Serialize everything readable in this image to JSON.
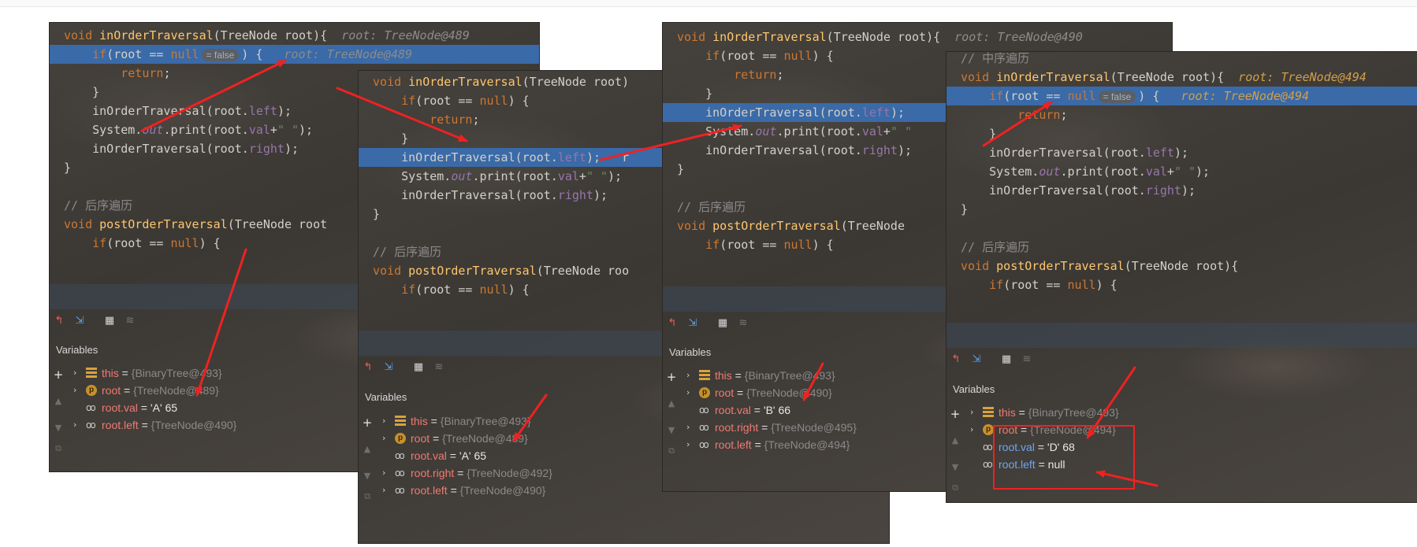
{
  "panels": [
    {
      "code": [
        [
          [
            "k",
            "void "
          ],
          [
            "fn",
            "inOrderTraversal"
          ],
          [
            "t",
            "(TreeNode root){  "
          ],
          [
            "hint",
            "root: TreeNode@489"
          ]
        ],
        [
          [
            "t",
            "    "
          ],
          [
            "k",
            "if"
          ],
          [
            "t",
            "(root == "
          ],
          [
            "k",
            "null"
          ],
          [
            "pill",
            "= false"
          ],
          [
            "t",
            ") {   "
          ],
          [
            "hint",
            "root: TreeNode@489"
          ]
        ],
        [
          [
            "t",
            "        "
          ],
          [
            "k",
            "return"
          ],
          [
            "t",
            ";"
          ]
        ],
        [
          [
            "t",
            "    }"
          ]
        ],
        [
          [
            "t",
            "    inOrderTraversal(root."
          ],
          [
            "fld",
            "left"
          ],
          [
            "t",
            ");"
          ]
        ],
        [
          [
            "t",
            "    System."
          ],
          [
            "it",
            "out"
          ],
          [
            "t",
            ".print(root."
          ],
          [
            "fld",
            "val"
          ],
          [
            "t",
            "+"
          ],
          [
            "str",
            "\" \""
          ],
          [
            "t",
            ");"
          ]
        ],
        [
          [
            "t",
            "    inOrderTraversal(root."
          ],
          [
            "fld",
            "right"
          ],
          [
            "t",
            ");"
          ]
        ],
        [
          [
            "t",
            "}"
          ]
        ],
        [
          [
            "t",
            ""
          ]
        ],
        [
          [
            "cm",
            "// 后序遍历"
          ]
        ],
        [
          [
            "k",
            "void "
          ],
          [
            "fn",
            "postOrderTraversal"
          ],
          [
            "t",
            "(TreeNode root"
          ]
        ],
        [
          [
            "t",
            "    "
          ],
          [
            "k",
            "if"
          ],
          [
            "t",
            "(root == "
          ],
          [
            "k",
            "null"
          ],
          [
            "t",
            ") {"
          ]
        ]
      ],
      "variables_title": "Variables",
      "variables": [
        {
          "chev": true,
          "icon": "list-icon",
          "name": "this",
          "val": "{BinaryTree@493}"
        },
        {
          "chev": true,
          "icon": "param-icon",
          "name": "root",
          "val": "{TreeNode@489}"
        },
        {
          "chev": false,
          "icon": "watch-icon",
          "name": "root.val",
          "val": "'A' 65",
          "plain": true
        },
        {
          "chev": true,
          "icon": "watch-icon",
          "name": "root.left",
          "val": "{TreeNode@490}"
        }
      ]
    },
    {
      "code": [
        [
          [
            "k",
            "void "
          ],
          [
            "fn",
            "inOrderTraversal"
          ],
          [
            "t",
            "(TreeNode root)"
          ]
        ],
        [
          [
            "t",
            "    "
          ],
          [
            "k",
            "if"
          ],
          [
            "t",
            "(root == "
          ],
          [
            "k",
            "null"
          ],
          [
            "t",
            ") {"
          ]
        ],
        [
          [
            "t",
            "        "
          ],
          [
            "k",
            "return"
          ],
          [
            "t",
            ";"
          ]
        ],
        [
          [
            "t",
            "    }"
          ]
        ],
        [
          [
            "t",
            "    inOrderTraversal(root."
          ],
          [
            "fld",
            "left"
          ],
          [
            "t",
            ");   r"
          ]
        ],
        [
          [
            "t",
            "    System."
          ],
          [
            "it",
            "out"
          ],
          [
            "t",
            ".print(root."
          ],
          [
            "fld",
            "val"
          ],
          [
            "t",
            "+"
          ],
          [
            "str",
            "\" \""
          ],
          [
            "t",
            ");"
          ]
        ],
        [
          [
            "t",
            "    inOrderTraversal(root."
          ],
          [
            "fld",
            "right"
          ],
          [
            "t",
            ");"
          ]
        ],
        [
          [
            "t",
            "}"
          ]
        ],
        [
          [
            "t",
            ""
          ]
        ],
        [
          [
            "cm",
            "// 后序遍历"
          ]
        ],
        [
          [
            "k",
            "void "
          ],
          [
            "fn",
            "postOrderTraversal"
          ],
          [
            "t",
            "(TreeNode roo"
          ]
        ],
        [
          [
            "t",
            "    "
          ],
          [
            "k",
            "if"
          ],
          [
            "t",
            "(root == "
          ],
          [
            "k",
            "null"
          ],
          [
            "t",
            ") {"
          ]
        ]
      ],
      "variables_title": "Variables",
      "variables": [
        {
          "chev": true,
          "icon": "list-icon",
          "name": "this",
          "val": "{BinaryTree@493}"
        },
        {
          "chev": true,
          "icon": "param-icon",
          "name": "root",
          "val": "{TreeNode@489}"
        },
        {
          "chev": false,
          "icon": "watch-icon",
          "name": "root.val",
          "val": "'A' 65",
          "plain": true
        },
        {
          "chev": true,
          "icon": "watch-icon",
          "name": "root.right",
          "val": "{TreeNode@492}"
        },
        {
          "chev": true,
          "icon": "watch-icon",
          "name": "root.left",
          "val": "{TreeNode@490}"
        }
      ]
    },
    {
      "code": [
        [
          [
            "k",
            "void "
          ],
          [
            "fn",
            "inOrderTraversal"
          ],
          [
            "t",
            "(TreeNode root){  "
          ],
          [
            "hint",
            "root: TreeNode@490"
          ]
        ],
        [
          [
            "t",
            "    "
          ],
          [
            "k",
            "if"
          ],
          [
            "t",
            "(root == "
          ],
          [
            "k",
            "null"
          ],
          [
            "t",
            ") {"
          ]
        ],
        [
          [
            "t",
            "        "
          ],
          [
            "k",
            "return"
          ],
          [
            "t",
            ";"
          ]
        ],
        [
          [
            "t",
            "    }"
          ]
        ],
        [
          [
            "t",
            "    inOrderTraversal(root."
          ],
          [
            "fld",
            "left"
          ],
          [
            "t",
            ");"
          ]
        ],
        [
          [
            "t",
            "    System."
          ],
          [
            "it",
            "out"
          ],
          [
            "t",
            ".print(root."
          ],
          [
            "fld",
            "val"
          ],
          [
            "t",
            "+"
          ],
          [
            "str",
            "\" \""
          ]
        ],
        [
          [
            "t",
            "    inOrderTraversal(root."
          ],
          [
            "fld",
            "right"
          ],
          [
            "t",
            ");"
          ]
        ],
        [
          [
            "t",
            "}"
          ]
        ],
        [
          [
            "t",
            ""
          ]
        ],
        [
          [
            "cm",
            "// 后序遍历"
          ]
        ],
        [
          [
            "k",
            "void "
          ],
          [
            "fn",
            "postOrderTraversal"
          ],
          [
            "t",
            "(TreeNode"
          ]
        ],
        [
          [
            "t",
            "    "
          ],
          [
            "k",
            "if"
          ],
          [
            "t",
            "(root == "
          ],
          [
            "k",
            "null"
          ],
          [
            "t",
            ") {"
          ]
        ]
      ],
      "variables_title": "Variables",
      "variables": [
        {
          "chev": true,
          "icon": "list-icon",
          "name": "this",
          "val": "{BinaryTree@493}"
        },
        {
          "chev": true,
          "icon": "param-icon",
          "name": "root",
          "val": "{TreeNode@490}"
        },
        {
          "chev": false,
          "icon": "watch-icon",
          "name": "root.val",
          "val": "'B' 66",
          "plain": true
        },
        {
          "chev": true,
          "icon": "watch-icon",
          "name": "root.right",
          "val": "{TreeNode@495}"
        },
        {
          "chev": true,
          "icon": "watch-icon",
          "name": "root.left",
          "val": "{TreeNode@494}"
        }
      ]
    },
    {
      "code": [
        [
          [
            "cm",
            "// 中序遍历"
          ]
        ],
        [
          [
            "k",
            "void "
          ],
          [
            "fn",
            "inOrderTraversal"
          ],
          [
            "t",
            "(TreeNode root){  "
          ],
          [
            "hintor",
            "root: TreeNode@494"
          ]
        ],
        [
          [
            "t",
            "    "
          ],
          [
            "k",
            "if"
          ],
          [
            "t",
            "(root == "
          ],
          [
            "k",
            "null"
          ],
          [
            "pill",
            "= false"
          ],
          [
            "t",
            ") {   "
          ],
          [
            "hintor",
            "root: TreeNode@494"
          ]
        ],
        [
          [
            "t",
            "        "
          ],
          [
            "k",
            "return"
          ],
          [
            "t",
            ";"
          ]
        ],
        [
          [
            "t",
            "    }"
          ]
        ],
        [
          [
            "t",
            "    inOrderTraversal(root."
          ],
          [
            "fld",
            "left"
          ],
          [
            "t",
            ");"
          ]
        ],
        [
          [
            "t",
            "    System."
          ],
          [
            "it",
            "out"
          ],
          [
            "t",
            ".print(root."
          ],
          [
            "fld",
            "val"
          ],
          [
            "t",
            "+"
          ],
          [
            "str",
            "\" \""
          ],
          [
            "t",
            ");"
          ]
        ],
        [
          [
            "t",
            "    inOrderTraversal(root."
          ],
          [
            "fld",
            "right"
          ],
          [
            "t",
            ");"
          ]
        ],
        [
          [
            "t",
            "}"
          ]
        ],
        [
          [
            "t",
            ""
          ]
        ],
        [
          [
            "cm",
            "// 后序遍历"
          ]
        ],
        [
          [
            "k",
            "void "
          ],
          [
            "fn",
            "postOrderTraversal"
          ],
          [
            "t",
            "(TreeNode root){"
          ]
        ],
        [
          [
            "t",
            "    "
          ],
          [
            "k",
            "if"
          ],
          [
            "t",
            "(root == "
          ],
          [
            "k",
            "null"
          ],
          [
            "t",
            ") {"
          ]
        ]
      ],
      "variables_title": "Variables",
      "variables": [
        {
          "chev": true,
          "icon": "list-icon",
          "name": "this",
          "val": "{BinaryTree@493}"
        },
        {
          "chev": true,
          "icon": "param-icon",
          "name": "root",
          "val": "{TreeNode@494}"
        },
        {
          "chev": false,
          "icon": "watch-icon",
          "name": "root.val",
          "val": "'D' 68",
          "plain": true,
          "blue": true
        },
        {
          "chev": false,
          "icon": "watch-icon",
          "name": "root.left",
          "val": "null",
          "plain": true,
          "blue": true
        }
      ]
    }
  ],
  "colors": {
    "annotation_red": "#ee2222",
    "highlight_blue": "#3a6aa8"
  }
}
